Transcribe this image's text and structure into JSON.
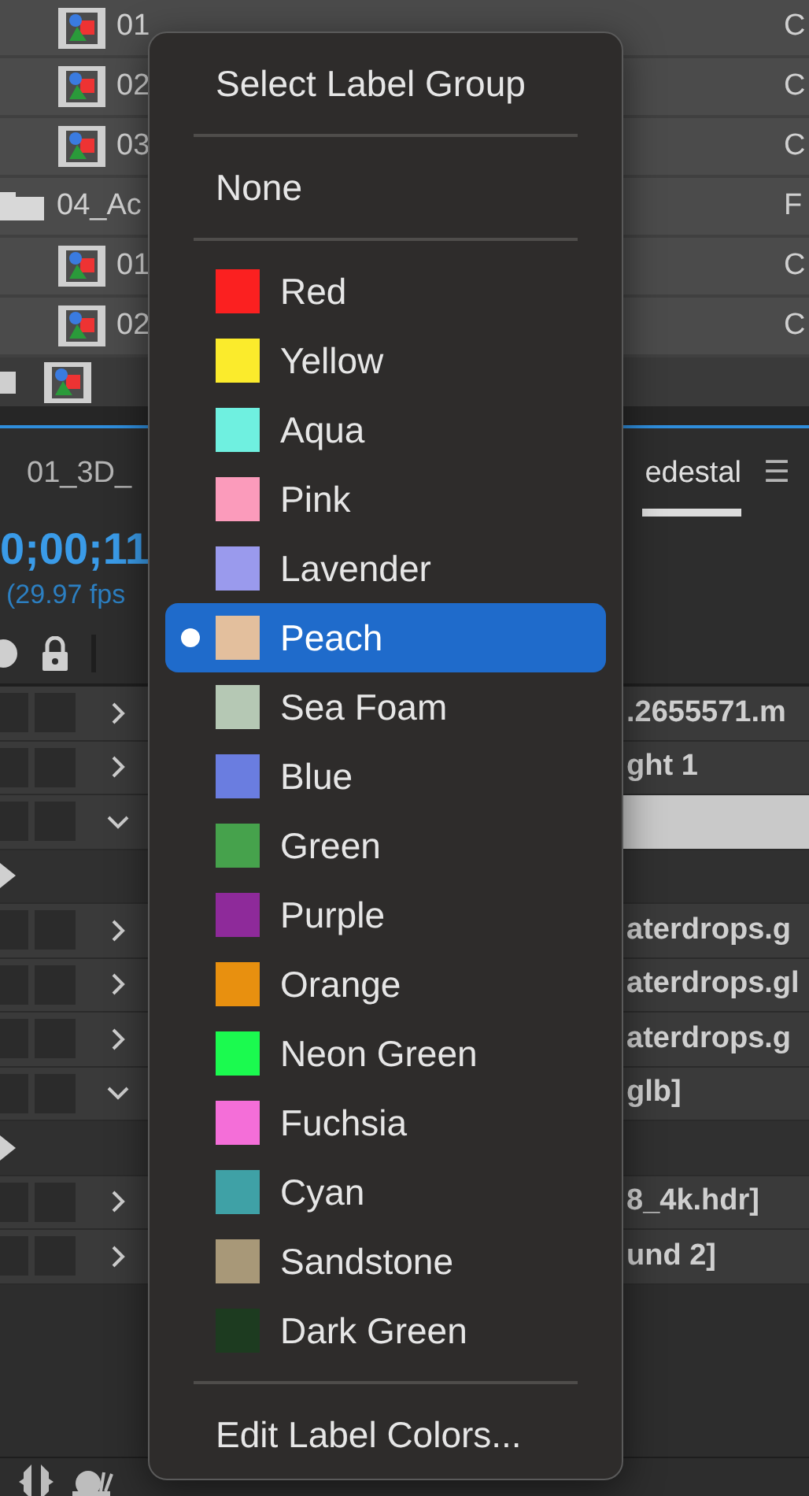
{
  "project_panel": {
    "rows": [
      {
        "kind": "comp",
        "name": "01",
        "type": "C"
      },
      {
        "kind": "comp",
        "name": "02",
        "type": "C"
      },
      {
        "kind": "comp",
        "name": "03",
        "type": "C"
      },
      {
        "kind": "folder",
        "name": "04_Ac",
        "type": "F"
      },
      {
        "kind": "comp",
        "name": "01",
        "type": "C"
      },
      {
        "kind": "comp",
        "name": "02",
        "type": "C"
      }
    ]
  },
  "timeline": {
    "tabs": [
      {
        "label": "01_3D_",
        "selected": false
      },
      {
        "label": "edestal",
        "selected": true
      }
    ],
    "menu_glyph": "☰",
    "timecode": "0;00;11",
    "fps": "(29.97 fps",
    "layers": [
      {
        "kind": "layer",
        "expanded": false,
        "selected": false,
        "source": ".2655571.m"
      },
      {
        "kind": "layer",
        "expanded": false,
        "selected": false,
        "source": "ght 1"
      },
      {
        "kind": "layer",
        "expanded": true,
        "selected": true
      },
      {
        "kind": "group"
      },
      {
        "kind": "layer",
        "expanded": false,
        "selected": false,
        "source": "aterdrops.g"
      },
      {
        "kind": "layer",
        "expanded": false,
        "selected": false,
        "source": "aterdrops.gl"
      },
      {
        "kind": "layer",
        "expanded": false,
        "selected": false,
        "source": "aterdrops.g"
      },
      {
        "kind": "layer",
        "expanded": true,
        "selected": false,
        "source": "glb]"
      },
      {
        "kind": "group"
      },
      {
        "kind": "layer",
        "expanded": false,
        "selected": false,
        "source": "8_4k.hdr]"
      },
      {
        "kind": "layer",
        "expanded": false,
        "selected": false,
        "source": "und 2]"
      }
    ]
  },
  "context_menu": {
    "title": "Select Label Group",
    "none": "None",
    "labels": [
      {
        "name": "Red",
        "color": "#fb2020",
        "selected": false
      },
      {
        "name": "Yellow",
        "color": "#fbeb2c",
        "selected": false
      },
      {
        "name": "Aqua",
        "color": "#6ff0e0",
        "selected": false
      },
      {
        "name": "Pink",
        "color": "#fb9bbb",
        "selected": false
      },
      {
        "name": "Lavender",
        "color": "#9a9aed",
        "selected": false
      },
      {
        "name": "Peach",
        "color": "#e3bf9d",
        "selected": true
      },
      {
        "name": "Sea Foam",
        "color": "#b5c8b4",
        "selected": false
      },
      {
        "name": "Blue",
        "color": "#6a7de0",
        "selected": false
      },
      {
        "name": "Green",
        "color": "#46a24c",
        "selected": false
      },
      {
        "name": "Purple",
        "color": "#8e2a9a",
        "selected": false
      },
      {
        "name": "Orange",
        "color": "#e8900f",
        "selected": false
      },
      {
        "name": "Neon Green",
        "color": "#1bfa4f",
        "selected": false
      },
      {
        "name": "Fuchsia",
        "color": "#f46ed8",
        "selected": false
      },
      {
        "name": "Cyan",
        "color": "#3fa1a6",
        "selected": false
      },
      {
        "name": "Sandstone",
        "color": "#a89878",
        "selected": false
      },
      {
        "name": "Dark Green",
        "color": "#1d3b20",
        "selected": false
      }
    ],
    "footer": "Edit Label Colors..."
  }
}
